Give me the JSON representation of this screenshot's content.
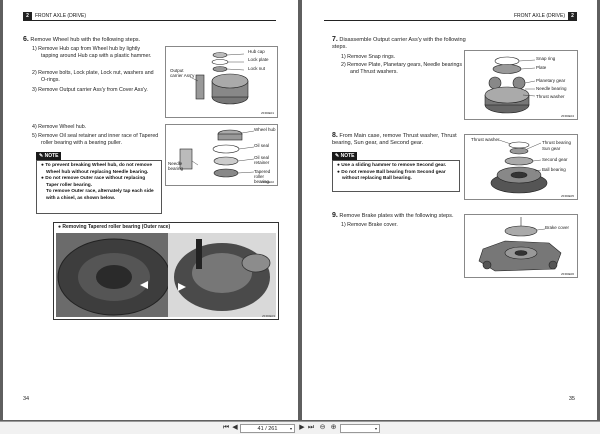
{
  "header": {
    "title": "FRONT AXLE (DRIVE)",
    "chapter": "2"
  },
  "left_page": {
    "number": "34",
    "step6": {
      "num": "6.",
      "title": "Remove Wheel hub with the following steps.",
      "sub1": "1)   Remove Hub cap from Wheel hub by lightly tapping around Hub cap with a plastic hammer.",
      "sub2": "2)   Remove bolts, Lock plate, Lock nut, washers and O-rings.",
      "sub3": "3)   Remove Output carrier Ass'y from Cover Ass'y.",
      "sub4": "4)   Remove Wheel hub.",
      "sub5": "5)   Remove Oil seal retainer and inner race of Tapered roller bearing with a bearing puller."
    },
    "fig1": {
      "labels": [
        "Hub cap",
        "Lock plate",
        "Lock nut",
        "Output carrier Ass'y"
      ],
      "code": "ZFR0E01"
    },
    "fig2": {
      "labels": [
        "Wheel hub",
        "Oil seal",
        "Oil seal retainer",
        "Needle bearing",
        "Tapered roller bearing"
      ],
      "code": "ZFR0E02"
    },
    "note": {
      "label": "NOTE",
      "b1": "●  To prevent breaking Wheel hub, do not remove Wheel hub without replacing Needle bearing.",
      "b2": "●  Do not remove Outer race without replacing Taper roller bearing.",
      "b3": "To remove Outer race, alternately tap each side with a chisel, as shown below."
    },
    "photo": {
      "caption": "●  Removing Tapered roller bearing (Outer race)",
      "code": "ZFR0E03"
    }
  },
  "right_page": {
    "number": "35",
    "step7": {
      "num": "7.",
      "title": "Disassemble Output carrier Ass'y with the following steps.",
      "sub1": "1)   Remove Snap rings.",
      "sub2": "2)   Remove Plate, Planetary gears, Needle bearings and Thrust washers."
    },
    "fig3": {
      "labels": [
        "Snap ring",
        "Plate",
        "Planetary gear",
        "Needle bearing",
        "Thrust washer"
      ],
      "code": "ZFR0E04"
    },
    "step8": {
      "num": "8.",
      "title": "From Main case, remove Thrust washer, Thrust bearing, Sun gear, and Second gear."
    },
    "fig4": {
      "labels": [
        "Thrust washer",
        "Thrust bearing",
        "Sun gear",
        "Second gear",
        "Ball bearing"
      ],
      "code": "ZFR0E05"
    },
    "note": {
      "label": "NOTE",
      "b1": "●  Use a sliding hammer to remove Second gear.",
      "b2": "●  Do not remove Ball bearing from Second gear without replacing Ball bearing."
    },
    "step9": {
      "num": "9.",
      "title": "Remove Brake plates with the following steps.",
      "sub1": "1)   Remove Brake cover."
    },
    "fig5": {
      "labels": [
        "Brake cover"
      ],
      "code": "ZFR0E06"
    }
  },
  "toolbar": {
    "page_display": "41 / 261",
    "zoom": "",
    "icons": [
      "first-page-icon",
      "prev-page-icon",
      "next-page-icon",
      "last-page-icon",
      "zoom-out-icon",
      "zoom-in-icon"
    ]
  },
  "colors": {
    "viewer_bg": "#5f5f5f",
    "ink": "#222222",
    "note_label": "#1a1a1a"
  }
}
